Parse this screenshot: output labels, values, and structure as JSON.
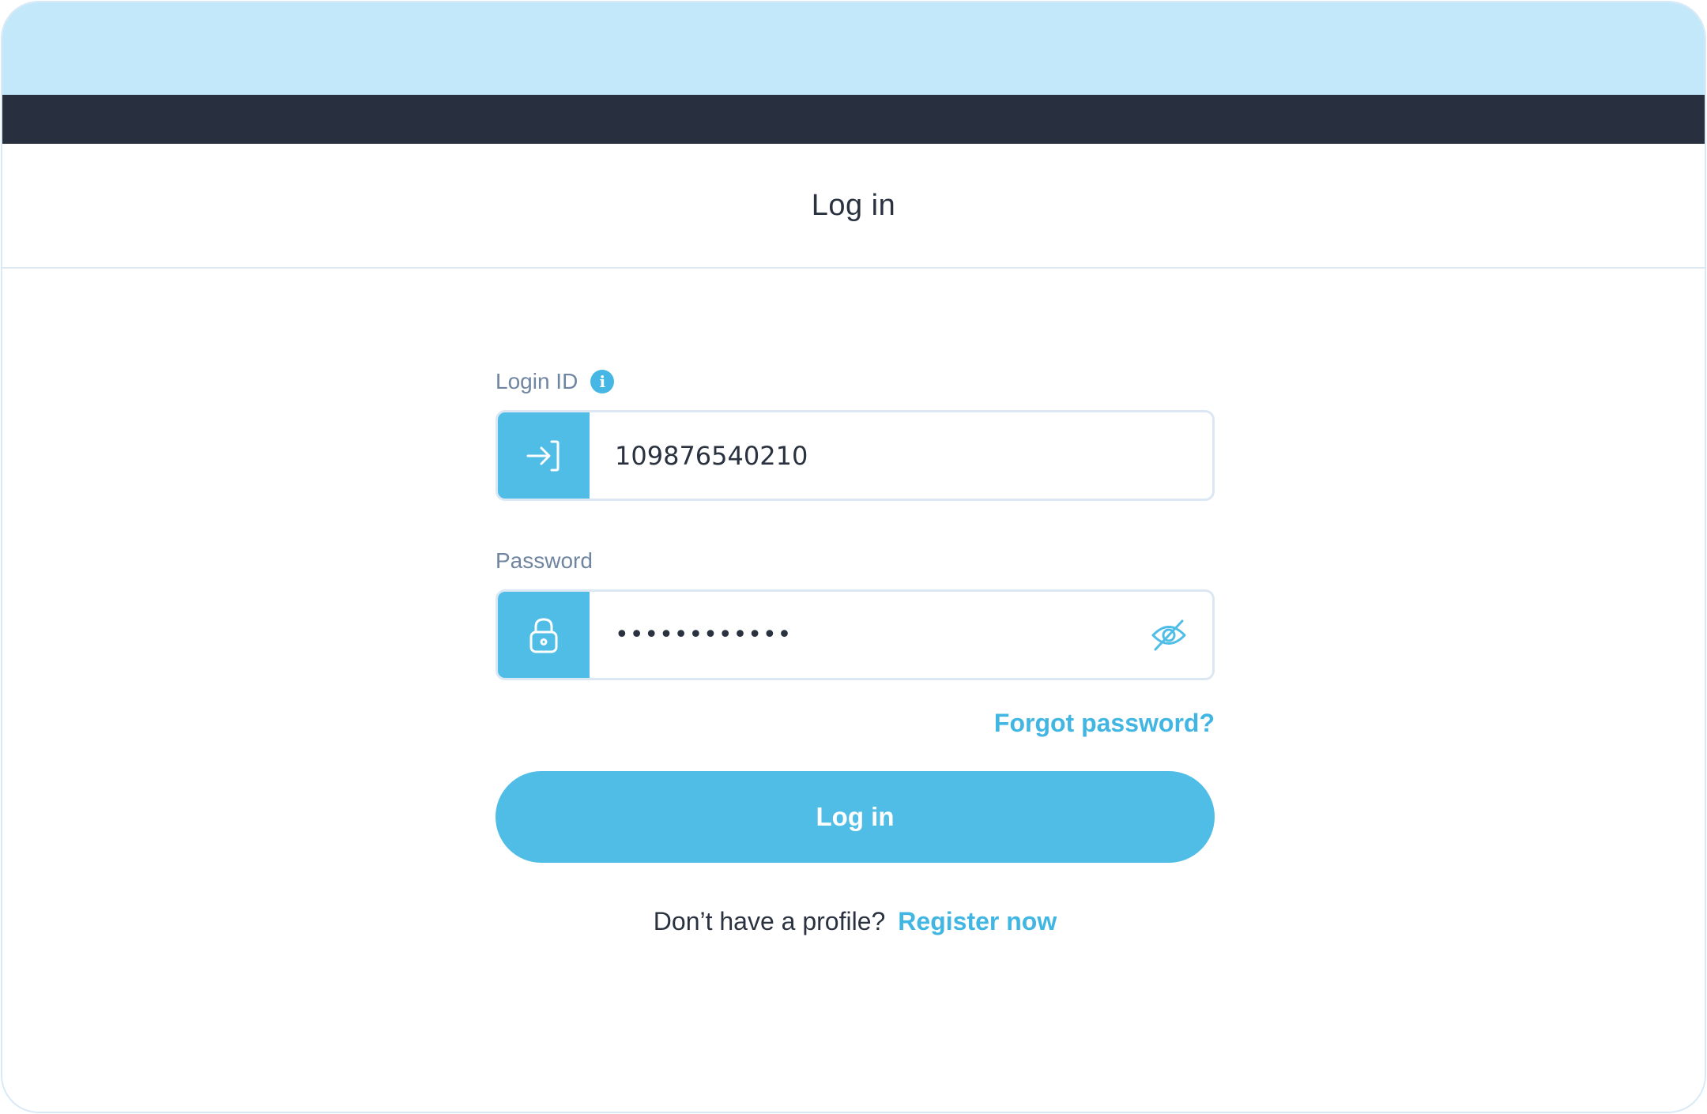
{
  "header": {
    "title": "Log in"
  },
  "form": {
    "login_id": {
      "label": "Login ID",
      "value": "109876540210",
      "icon": "login-arrow-icon"
    },
    "password": {
      "label": "Password",
      "value": "••••••••••••",
      "icon": "lock-icon",
      "toggle_icon": "eye-slash-icon"
    },
    "forgot_label": "Forgot password?",
    "submit_label": "Log in",
    "register_prompt": "Don’t have a profile?",
    "register_link": "Register now"
  },
  "colors": {
    "top_band": "#c2e8fa",
    "dark_bar": "#282f3e",
    "accent": "#4fbde6",
    "link": "#41b6e3",
    "label": "#6f85a0",
    "text": "#2a3240"
  }
}
